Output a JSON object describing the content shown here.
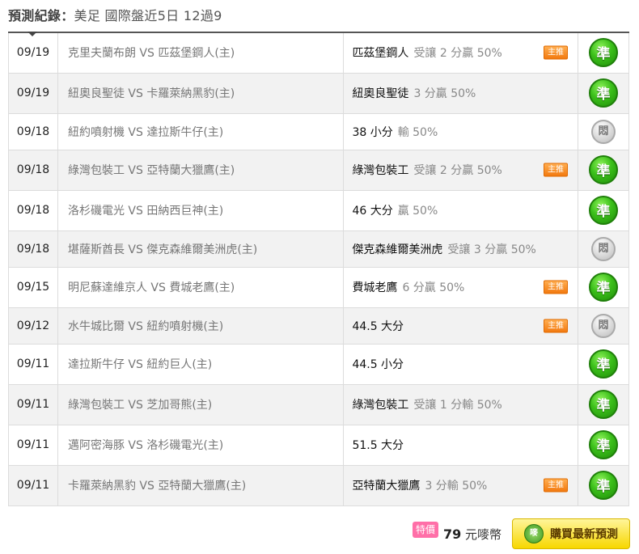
{
  "header": {
    "label": "預測紀錄：",
    "summary": "美足 國際盤近5日 12過9"
  },
  "rows": [
    {
      "date": "09/19",
      "match": "克里夫蘭布朗 VS 匹茲堡鋼人(主)",
      "team": "匹茲堡鋼人",
      "result": "受讓 2 分贏 50%",
      "tag": "主推",
      "status": "準",
      "status_type": "win"
    },
    {
      "date": "09/19",
      "match": "紐奧良聖徒 VS 卡羅萊納黑豹(主)",
      "team": "紐奧良聖徒",
      "result": "3 分贏 50%",
      "tag": "",
      "status": "準",
      "status_type": "win"
    },
    {
      "date": "09/18",
      "match": "紐約噴射機 VS 達拉斯牛仔(主)",
      "team": "38 小分",
      "result": "輸 50%",
      "tag": "",
      "status": "悶",
      "status_type": "push"
    },
    {
      "date": "09/18",
      "match": "綠灣包裝工 VS 亞特蘭大獵鷹(主)",
      "team": "綠灣包裝工",
      "result": "受讓 2 分贏 50%",
      "tag": "主推",
      "status": "準",
      "status_type": "win"
    },
    {
      "date": "09/18",
      "match": "洛杉磯電光 VS 田納西巨神(主)",
      "team": "46 大分",
      "result": "贏 50%",
      "tag": "",
      "status": "準",
      "status_type": "win"
    },
    {
      "date": "09/18",
      "match": "堪薩斯酋長 VS 傑克森維爾美洲虎(主)",
      "team": "傑克森維爾美洲虎",
      "result": "受讓 3 分贏 50%",
      "tag": "",
      "status": "悶",
      "status_type": "push"
    },
    {
      "date": "09/15",
      "match": "明尼蘇達維京人 VS 費城老鷹(主)",
      "team": "費城老鷹",
      "result": "6 分贏 50%",
      "tag": "主推",
      "status": "準",
      "status_type": "win"
    },
    {
      "date": "09/12",
      "match": "水牛城比爾 VS 紐約噴射機(主)",
      "team": "44.5 大分",
      "result": "",
      "tag": "主推",
      "status": "悶",
      "status_type": "push"
    },
    {
      "date": "09/11",
      "match": "達拉斯牛仔 VS 紐約巨人(主)",
      "team": "44.5 小分",
      "result": "",
      "tag": "",
      "status": "準",
      "status_type": "win"
    },
    {
      "date": "09/11",
      "match": "綠灣包裝工 VS 芝加哥熊(主)",
      "team": "綠灣包裝工",
      "result": "受讓 1 分輸 50%",
      "tag": "",
      "status": "準",
      "status_type": "win"
    },
    {
      "date": "09/11",
      "match": "邁阿密海豚 VS 洛杉磯電光(主)",
      "team": "51.5 大分",
      "result": "",
      "tag": "",
      "status": "準",
      "status_type": "win"
    },
    {
      "date": "09/11",
      "match": "卡羅萊納黑豹 VS 亞特蘭大獵鷹(主)",
      "team": "亞特蘭大獵鷹",
      "result": "3 分輸 50%",
      "tag": "主推",
      "status": "準",
      "status_type": "win"
    }
  ],
  "footer": {
    "sale_tag": "特價",
    "price_value": "79",
    "price_unit": "元嘜幣",
    "buy_icon": "嘜",
    "buy_label": "購買最新預測"
  }
}
